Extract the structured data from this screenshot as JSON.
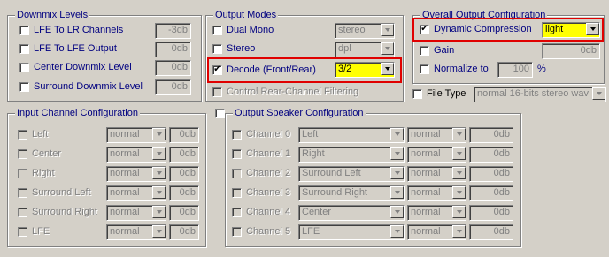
{
  "downmix": {
    "title": "Downmix Levels",
    "items": [
      {
        "label": "LFE To LR Channels",
        "value": "-3db"
      },
      {
        "label": "LFE To LFE Output",
        "value": "0db"
      },
      {
        "label": "Center Downmix Level",
        "value": "0db"
      },
      {
        "label": "Surround Downmix Level",
        "value": "0db"
      }
    ]
  },
  "output_modes": {
    "title": "Output Modes",
    "dual_mono": {
      "label": "Dual Mono",
      "value": "stereo"
    },
    "stereo": {
      "label": "Stereo",
      "value": "dpl"
    },
    "decode": {
      "label": "Decode (Front/Rear)",
      "value": "3/2",
      "checkmark": "✔"
    },
    "rear_filter": {
      "label": "Control Rear-Channel Filtering"
    }
  },
  "overall": {
    "title": "Overall Output Configuration",
    "dynamic": {
      "label": "Dynamic Compression",
      "value": "light",
      "checkmark": "✔"
    },
    "gain": {
      "label": "Gain",
      "value": "0db"
    },
    "normalize": {
      "label": "Normalize to",
      "value": "100",
      "unit": "%"
    }
  },
  "file_type": {
    "label": "File Type",
    "value": "normal 16-bits stereo wav"
  },
  "input_config": {
    "title": "Input Channel Configuration",
    "rows": [
      {
        "label": "Left",
        "mode": "normal",
        "gain": "0db"
      },
      {
        "label": "Center",
        "mode": "normal",
        "gain": "0db"
      },
      {
        "label": "Right",
        "mode": "normal",
        "gain": "0db"
      },
      {
        "label": "Surround Left",
        "mode": "normal",
        "gain": "0db"
      },
      {
        "label": "Surround Right",
        "mode": "normal",
        "gain": "0db"
      },
      {
        "label": "LFE",
        "mode": "normal",
        "gain": "0db"
      }
    ]
  },
  "output_config": {
    "title": "Output Speaker Configuration",
    "rows": [
      {
        "label": "Channel 0",
        "source": "Left",
        "mode": "normal",
        "gain": "0db"
      },
      {
        "label": "Channel 1",
        "source": "Right",
        "mode": "normal",
        "gain": "0db"
      },
      {
        "label": "Channel 2",
        "source": "Surround Left",
        "mode": "normal",
        "gain": "0db"
      },
      {
        "label": "Channel 3",
        "source": "Surround Right",
        "mode": "normal",
        "gain": "0db"
      },
      {
        "label": "Channel 4",
        "source": "Center",
        "mode": "normal",
        "gain": "0db"
      },
      {
        "label": "Channel 5",
        "source": "LFE",
        "mode": "normal",
        "gain": "0db"
      }
    ]
  },
  "colors": {
    "highlight": "#e00000",
    "active_field": "#ffff00",
    "label_text": "#000080"
  }
}
